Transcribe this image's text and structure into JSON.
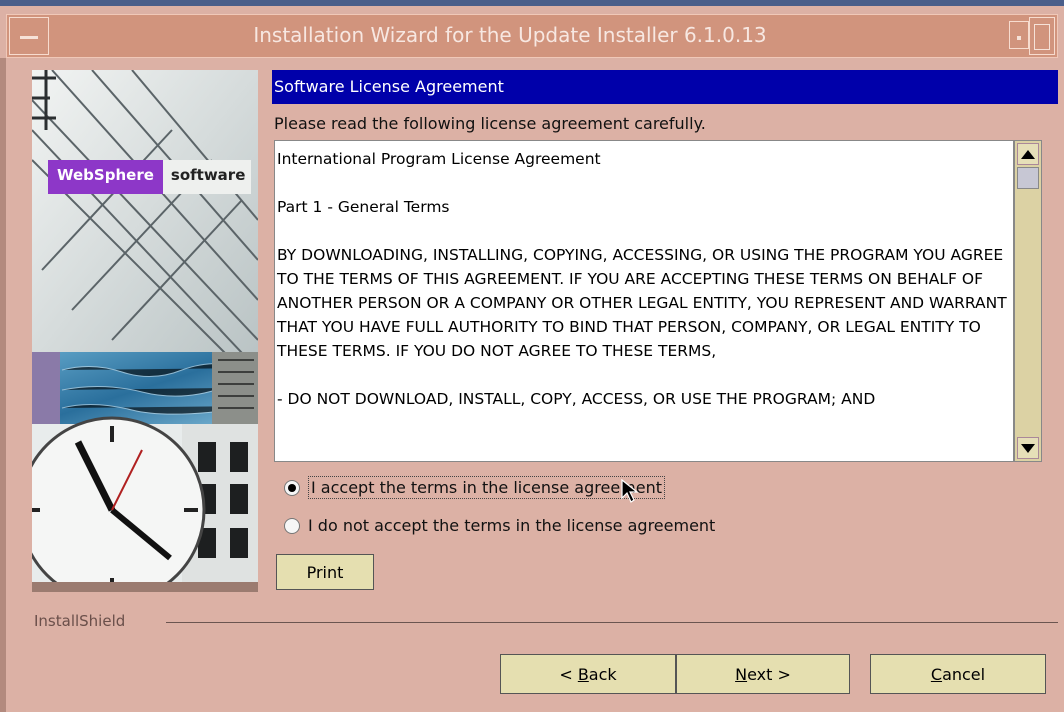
{
  "window": {
    "title": "Installation Wizard for the Update Installer 6.1.0.13"
  },
  "sidebar": {
    "brand_product": "WebSphere",
    "brand_suffix": "software"
  },
  "panel": {
    "header": "Software License Agreement",
    "instruction": "Please read the following license agreement carefully.",
    "license_paragraphs": [
      "International Program License Agreement",
      "",
      "Part 1 - General Terms",
      "",
      "BY DOWNLOADING, INSTALLING, COPYING, ACCESSING, OR USING THE PROGRAM YOU AGREE TO THE TERMS OF THIS AGREEMENT. IF YOU ARE ACCEPTING THESE TERMS ON BEHALF OF ANOTHER PERSON OR A COMPANY OR OTHER LEGAL ENTITY, YOU REPRESENT AND WARRANT THAT YOU HAVE FULL AUTHORITY TO BIND THAT PERSON, COMPANY, OR LEGAL ENTITY TO THESE TERMS. IF YOU DO NOT AGREE TO THESE TERMS,",
      "",
      "- DO NOT DOWNLOAD, INSTALL, COPY, ACCESS, OR USE THE PROGRAM; AND"
    ],
    "accept_label": "I accept the terms in the license agreement",
    "decline_label": "I do not accept the terms in the license agreement",
    "accept_selected": true,
    "print_label": "Print"
  },
  "footer": {
    "vendor": "InstallShield",
    "back_prefix": "< ",
    "back_mnemonic": "B",
    "back_rest": "ack",
    "next_mnemonic": "N",
    "next_rest": "ext >",
    "cancel_mnemonic": "C",
    "cancel_rest": "ancel"
  }
}
